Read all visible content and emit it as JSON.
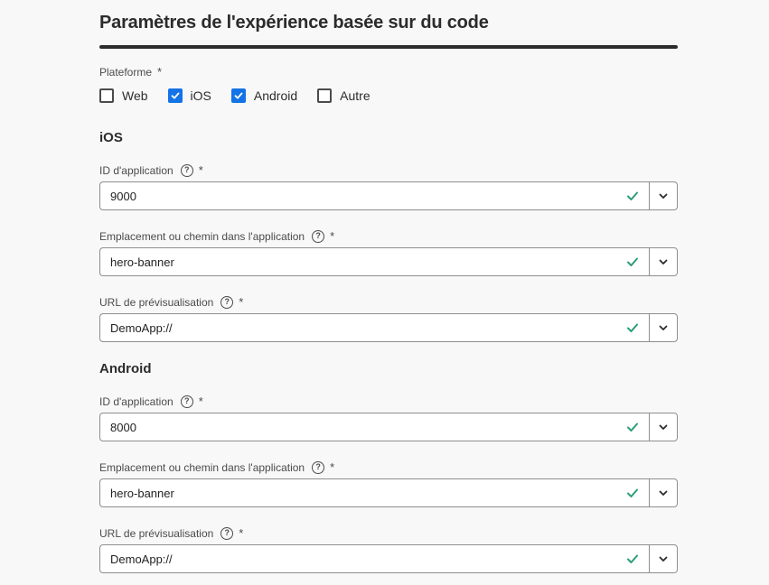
{
  "page_title": "Paramètres de l'expérience basée sur du code",
  "platform": {
    "label": "Plateforme",
    "required": "*",
    "options": [
      {
        "label": "Web",
        "checked": false
      },
      {
        "label": "iOS",
        "checked": true
      },
      {
        "label": "Android",
        "checked": true
      },
      {
        "label": "Autre",
        "checked": false
      }
    ]
  },
  "help_glyph": "?",
  "ios": {
    "heading": "iOS",
    "app_id": {
      "label": "ID d'application",
      "required": "*",
      "value": "9000"
    },
    "location": {
      "label": "Emplacement ou chemin dans l'application",
      "required": "*",
      "value": "hero-banner"
    },
    "preview": {
      "label": "URL de prévisualisation",
      "required": "*",
      "value": "DemoApp://"
    }
  },
  "android": {
    "heading": "Android",
    "app_id": {
      "label": "ID d'application",
      "required": "*",
      "value": "8000"
    },
    "location": {
      "label": "Emplacement ou chemin dans l'application",
      "required": "*",
      "value": "hero-banner"
    },
    "preview": {
      "label": "URL de prévisualisation",
      "required": "*",
      "value": "DemoApp://"
    }
  },
  "colors": {
    "accent": "#1473e6",
    "valid": "#2d9d78"
  }
}
